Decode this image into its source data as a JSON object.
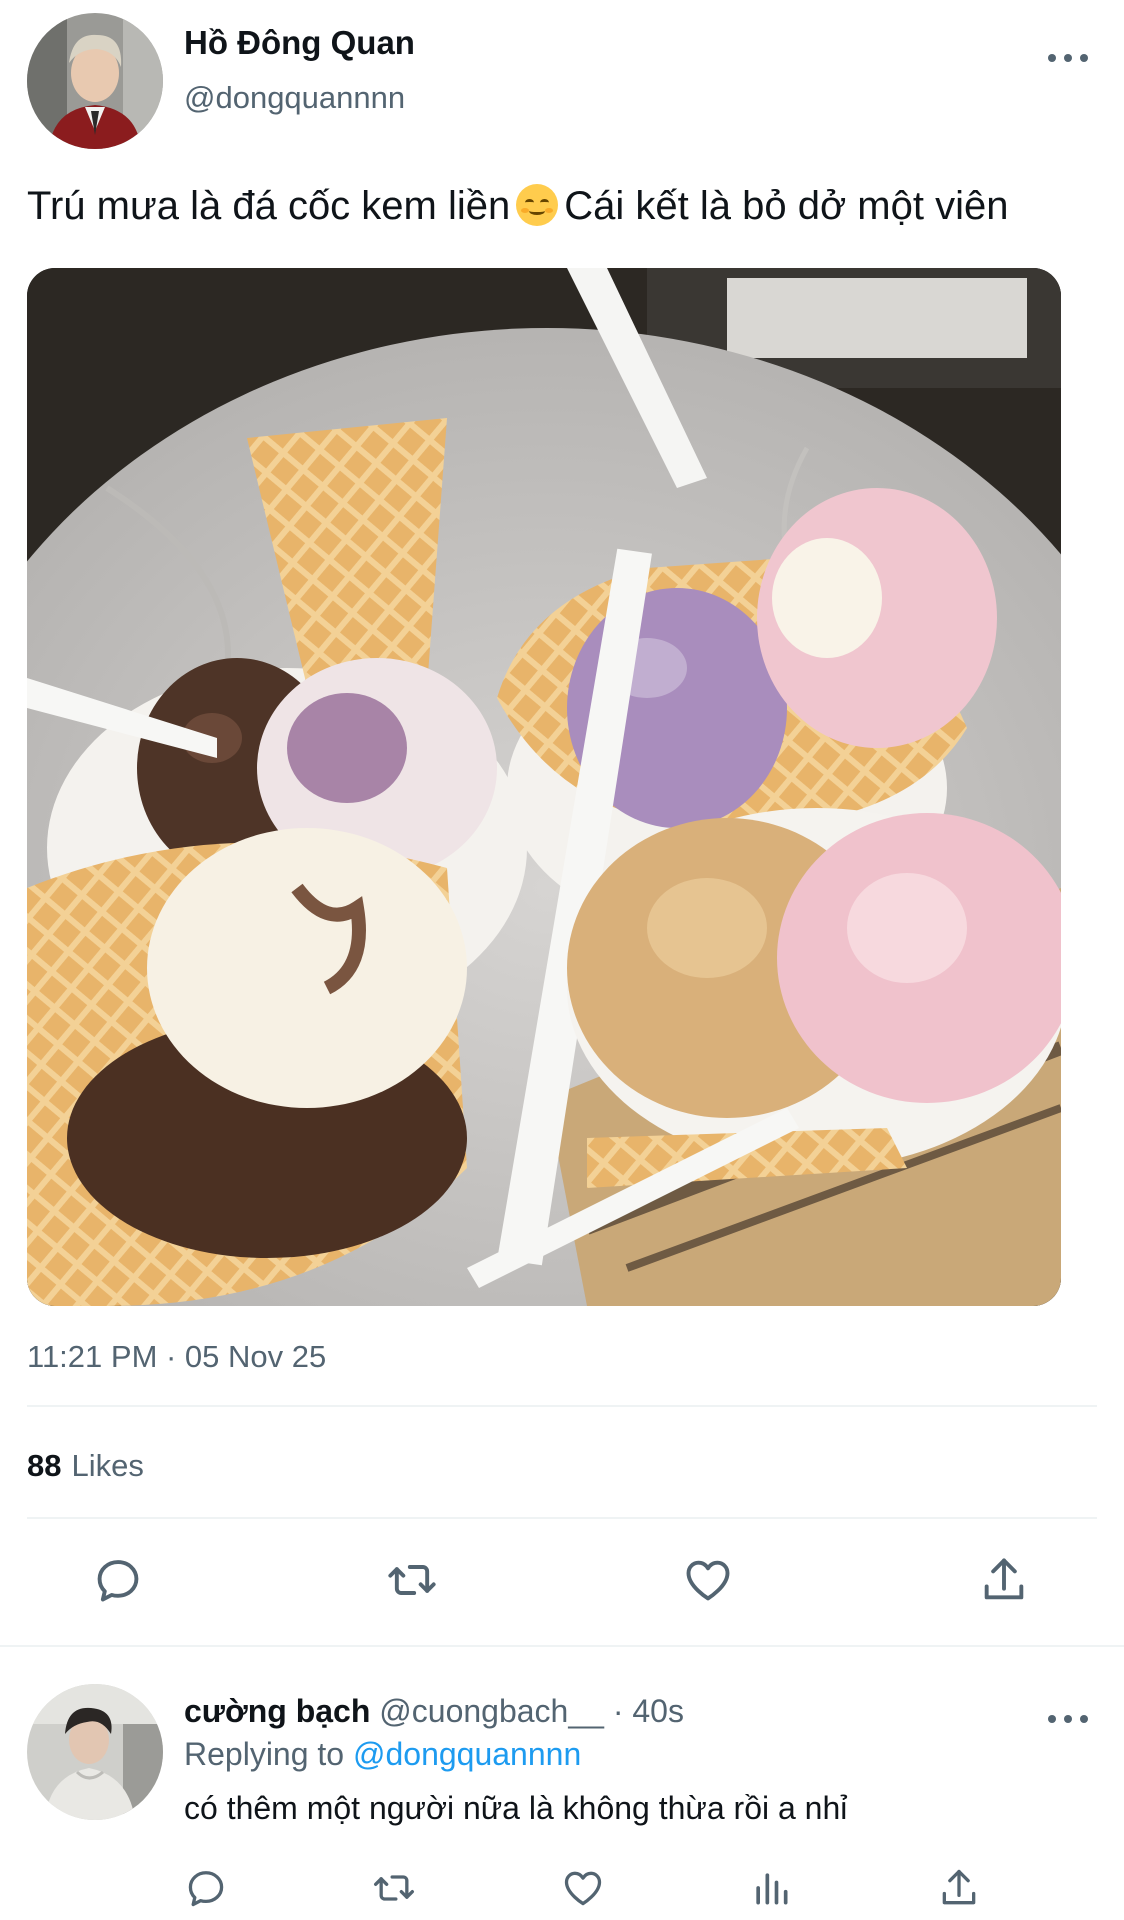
{
  "tweet": {
    "author": {
      "name": "Hồ Đông Quan",
      "handle": "@dongquannnn"
    },
    "text_before_emoji": "Trú mưa là đá cốc kem liền",
    "emoji": "relieved-face-emoji",
    "text_after_emoji": "Cái kết là bỏ dở một viên",
    "timestamp": "11:21 PM · 05 Nov 25",
    "likes_count": "88",
    "likes_label": "Likes",
    "actions": [
      "reply-icon",
      "retweet-icon",
      "like-icon",
      "share-icon"
    ]
  },
  "reply": {
    "author": {
      "name": "cường bạch",
      "handle": "@cuongbach__"
    },
    "separator": "·",
    "time": "40s",
    "replying_label": "Replying to",
    "replying_to": "@dongquannnn",
    "text": "có thêm một người nữa là không thừa rồi a nhỉ",
    "actions": [
      "reply-icon",
      "retweet-icon",
      "like-icon",
      "analytics-icon",
      "share-icon"
    ]
  },
  "colors": {
    "text_primary": "#0f1419",
    "text_secondary": "#536471",
    "link": "#1d9bf0",
    "divider": "#eff3f4"
  }
}
